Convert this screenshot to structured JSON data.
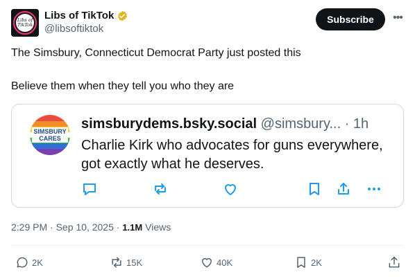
{
  "author": {
    "display_name": "Libs of TikTok",
    "handle": "@libsoftiktok",
    "avatar_text_line1": "Libs of",
    "avatar_text_line2": "TikTok"
  },
  "header": {
    "subscribe_label": "Subscribe",
    "more_icon": "more-horizontal-icon"
  },
  "tweet": {
    "line1": "The Simsbury, Connecticut Democrat Party just posted this",
    "line2": "Believe them when they tell you who they are"
  },
  "quoted": {
    "avatar_line1": "SIMSBURY",
    "avatar_line2": "CARES",
    "name": "simsburydems.bsky.social",
    "handle_time": "@simsbury... · 1h",
    "text": "Charlie Kirk who advocates for guns everywhere, got exactly what he deserves.",
    "icons": [
      "reply-icon",
      "repost-icon",
      "like-icon",
      "bookmark-icon",
      "share-icon",
      "more-icon"
    ]
  },
  "meta": {
    "time_date": "2:29 PM · Sep 10, 2025 · ",
    "views_count": "1.1M",
    "views_label": " Views"
  },
  "actions": {
    "replies": "2K",
    "reposts": "15K",
    "likes": "40K",
    "bookmarks": "2K"
  },
  "colors": {
    "text": "#0f1419",
    "secondary": "#536471",
    "border": "#cfd9de",
    "verified_gold": "#e2b719",
    "quote_icons": "#1d9bf0"
  }
}
